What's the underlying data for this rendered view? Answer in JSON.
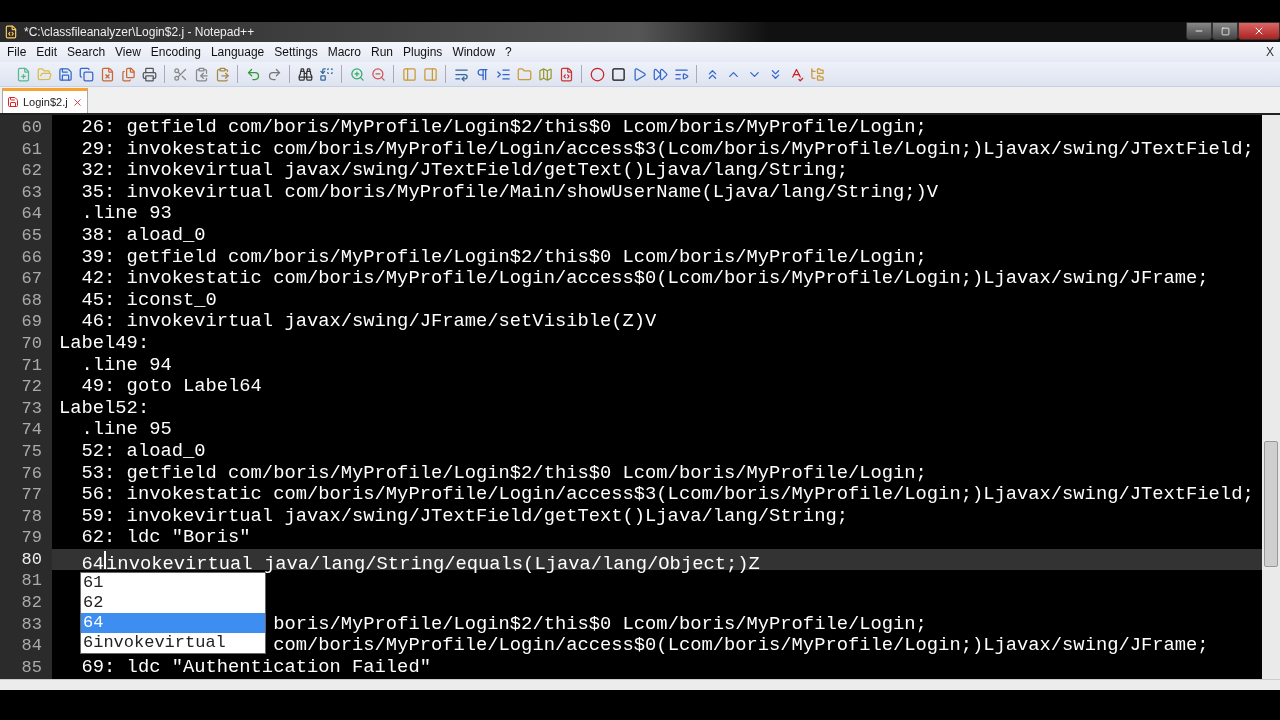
{
  "window": {
    "title": "*C:\\classfileanalyzer\\Login$2.j - Notepad++"
  },
  "menu": [
    {
      "label": "File"
    },
    {
      "label": "Edit"
    },
    {
      "label": "Search"
    },
    {
      "label": "View"
    },
    {
      "label": "Encoding"
    },
    {
      "label": "Language"
    },
    {
      "label": "Settings"
    },
    {
      "label": "Macro"
    },
    {
      "label": "Run"
    },
    {
      "label": "Plugins"
    },
    {
      "label": "Window"
    },
    {
      "label": "?"
    }
  ],
  "menu_close": "X",
  "tabs": [
    {
      "label": "Login$2.j",
      "selected": true,
      "modified": true
    }
  ],
  "editor": {
    "lines": [
      {
        "number": "60",
        "text": "  26: getfield com/boris/MyProfile/Login$2/this$0 Lcom/boris/MyProfile/Login;",
        "current": false
      },
      {
        "number": "61",
        "text": "  29: invokestatic com/boris/MyProfile/Login/access$3(Lcom/boris/MyProfile/Login;)Ljavax/swing/JTextField;",
        "current": false
      },
      {
        "number": "62",
        "text": "  32: invokevirtual javax/swing/JTextField/getText()Ljava/lang/String;",
        "current": false
      },
      {
        "number": "63",
        "text": "  35: invokevirtual com/boris/MyProfile/Main/showUserName(Ljava/lang/String;)V",
        "current": false
      },
      {
        "number": "64",
        "text": "  .line 93",
        "current": false
      },
      {
        "number": "65",
        "text": "  38: aload_0",
        "current": false
      },
      {
        "number": "66",
        "text": "  39: getfield com/boris/MyProfile/Login$2/this$0 Lcom/boris/MyProfile/Login;",
        "current": false
      },
      {
        "number": "67",
        "text": "  42: invokestatic com/boris/MyProfile/Login/access$0(Lcom/boris/MyProfile/Login;)Ljavax/swing/JFrame;",
        "current": false
      },
      {
        "number": "68",
        "text": "  45: iconst_0",
        "current": false
      },
      {
        "number": "69",
        "text": "  46: invokevirtual javax/swing/JFrame/setVisible(Z)V",
        "current": false
      },
      {
        "number": "70",
        "text": "Label49:",
        "current": false
      },
      {
        "number": "71",
        "text": "  .line 94",
        "current": false
      },
      {
        "number": "72",
        "text": "  49: goto Label64",
        "current": false
      },
      {
        "number": "73",
        "text": "Label52:",
        "current": false
      },
      {
        "number": "74",
        "text": "  .line 95",
        "current": false
      },
      {
        "number": "75",
        "text": "  52: aload_0",
        "current": false
      },
      {
        "number": "76",
        "text": "  53: getfield com/boris/MyProfile/Login$2/this$0 Lcom/boris/MyProfile/Login;",
        "current": false
      },
      {
        "number": "77",
        "text": "  56: invokestatic com/boris/MyProfile/Login/access$3(Lcom/boris/MyProfile/Login;)Ljavax/swing/JTextField;",
        "current": false
      },
      {
        "number": "78",
        "text": "  59: invokevirtual javax/swing/JTextField/getText()Ljava/lang/String;",
        "current": false
      },
      {
        "number": "79",
        "text": "  62: ldc \"Boris\"",
        "current": false
      },
      {
        "number": "80",
        "text": "  64invokevirtual java/lang/String/equals(Ljava/lang/Object;)Z",
        "current": true
      },
      {
        "number": "81",
        "current": false
      },
      {
        "number": "82",
        "current": false
      },
      {
        "number": "83",
        "text": "                   boris/MyProfile/Login$2/this$0 Lcom/boris/MyProfile/Login;",
        "current": false
      },
      {
        "number": "84",
        "text": "                   com/boris/MyProfile/Login/access$0(Lcom/boris/MyProfile/Login;)Ljavax/swing/JFrame;",
        "current": false
      },
      {
        "number": "85",
        "text": "  69: ldc \"Authentication Failed\"",
        "current": false
      }
    ]
  },
  "autocomplete": [
    {
      "label": "61",
      "selected": false
    },
    {
      "label": "62",
      "selected": false
    },
    {
      "label": "64",
      "selected": true
    },
    {
      "label": "6invokevirtual",
      "selected": false
    }
  ]
}
